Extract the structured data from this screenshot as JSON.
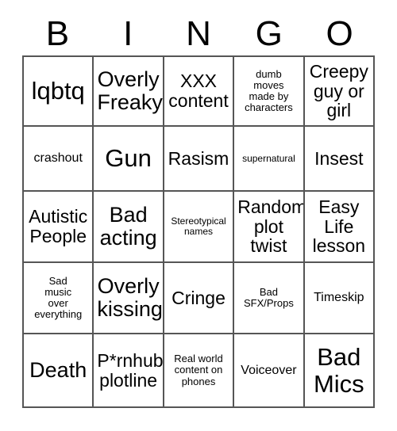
{
  "card": {
    "title_letters": [
      "B",
      "I",
      "N",
      "G",
      "O"
    ],
    "grid": {
      "rows": 5,
      "columns": 5,
      "border_color": "#555555",
      "background_color": "#ffffff",
      "text_color": "#000000"
    },
    "cells": [
      [
        {
          "text": "lqbtq",
          "size": "fs-xl"
        },
        {
          "text": "Overly\nFreaky",
          "size": "fs-lg"
        },
        {
          "text": "XXX\ncontent",
          "size": "fs-md"
        },
        {
          "text": "dumb\nmoves\nmade by\ncharacters",
          "size": "fs-xs"
        },
        {
          "text": "Creepy\nguy or\ngirl",
          "size": "fs-md"
        }
      ],
      [
        {
          "text": "crashout",
          "size": "fs-sm"
        },
        {
          "text": "Gun",
          "size": "fs-xl"
        },
        {
          "text": "Rasism",
          "size": "fs-md"
        },
        {
          "text": "supernatural",
          "size": "fs-xxs"
        },
        {
          "text": "Insest",
          "size": "fs-md"
        }
      ],
      [
        {
          "text": "Autistic\nPeople",
          "size": "fs-md"
        },
        {
          "text": "Bad\nacting",
          "size": "fs-lg"
        },
        {
          "text": "Stereotypical\nnames",
          "size": "fs-xxs"
        },
        {
          "text": "Random\nplot\ntwist",
          "size": "fs-md"
        },
        {
          "text": "Easy\nLife\nlesson",
          "size": "fs-md"
        }
      ],
      [
        {
          "text": "Sad\nmusic\nover\neverything",
          "size": "fs-xs"
        },
        {
          "text": "Overly\nkissing",
          "size": "fs-lg"
        },
        {
          "text": "Cringe",
          "size": "fs-md"
        },
        {
          "text": "Bad\nSFX/Props",
          "size": "fs-xs"
        },
        {
          "text": "Timeskip",
          "size": "fs-sm"
        }
      ],
      [
        {
          "text": "Death",
          "size": "fs-lg"
        },
        {
          "text": "P*rnhub\nplotline",
          "size": "fs-md"
        },
        {
          "text": "Real world\ncontent on\nphones",
          "size": "fs-xs"
        },
        {
          "text": "Voiceover",
          "size": "fs-sm"
        },
        {
          "text": "Bad\nMics",
          "size": "fs-xl"
        }
      ]
    ]
  }
}
